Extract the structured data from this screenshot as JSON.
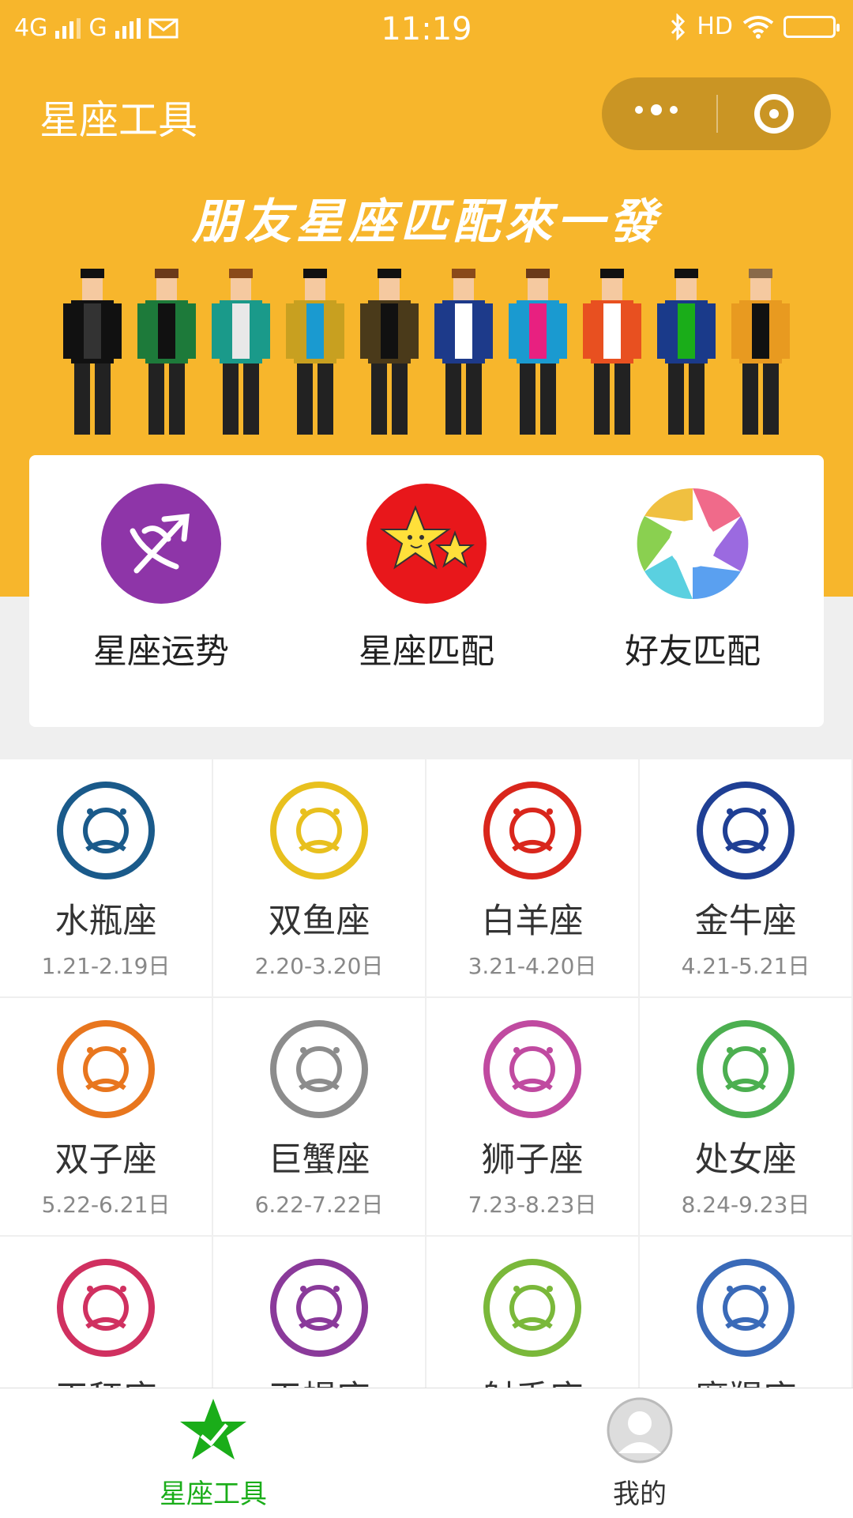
{
  "status_bar": {
    "network1": "4G",
    "network2": "G",
    "time": "11:19",
    "hd": "HD"
  },
  "nav": {
    "title": "星座工具"
  },
  "banner": {
    "slogan": "朋友星座匹配來一發"
  },
  "features": [
    {
      "label": "星座运势",
      "icon": "sagittarius-icon"
    },
    {
      "label": "星座匹配",
      "icon": "stars-icon"
    },
    {
      "label": "好友匹配",
      "icon": "aperture-icon"
    }
  ],
  "zodiacs": [
    {
      "name": "水瓶座",
      "dates": "1.21-2.19日",
      "color": "#1a5a8a"
    },
    {
      "name": "双鱼座",
      "dates": "2.20-3.20日",
      "color": "#e8c01e"
    },
    {
      "name": "白羊座",
      "dates": "3.21-4.20日",
      "color": "#d9261c"
    },
    {
      "name": "金牛座",
      "dates": "4.21-5.21日",
      "color": "#1f3f94"
    },
    {
      "name": "双子座",
      "dates": "5.22-6.21日",
      "color": "#e8761e"
    },
    {
      "name": "巨蟹座",
      "dates": "6.22-7.22日",
      "color": "#8c8c8c"
    },
    {
      "name": "狮子座",
      "dates": "7.23-8.23日",
      "color": "#c04aa0"
    },
    {
      "name": "处女座",
      "dates": "8.24-9.23日",
      "color": "#4caf50"
    },
    {
      "name": "天秤座",
      "dates": "",
      "color": "#d03060"
    },
    {
      "name": "天蝎座",
      "dates": "",
      "color": "#8a3a9a"
    },
    {
      "name": "射手座",
      "dates": "",
      "color": "#7ab83a"
    },
    {
      "name": "摩羯座",
      "dates": "",
      "color": "#3a6ab8"
    }
  ],
  "tabs": [
    {
      "label": "星座工具",
      "active": true,
      "color": "#1aad19"
    },
    {
      "label": "我的",
      "active": false,
      "color": "#333333"
    }
  ]
}
